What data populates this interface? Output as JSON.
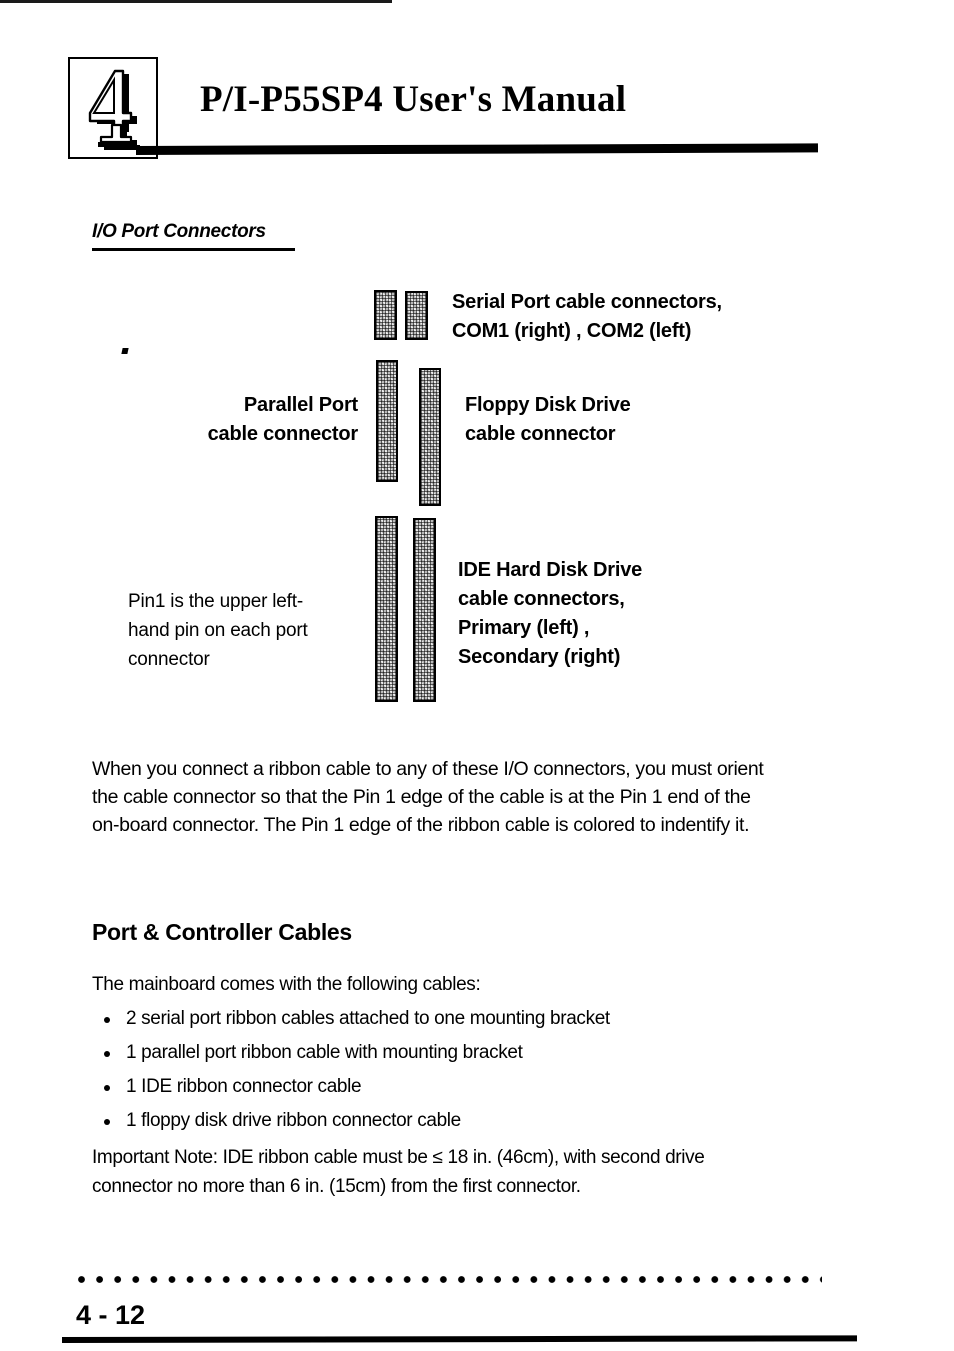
{
  "header": {
    "chapter_number": "4",
    "title": "P/I-P55SP4 User's Manual"
  },
  "section": {
    "heading": "I/O Port Connectors"
  },
  "diagram": {
    "serial_label_line1": "Serial Port cable connectors,",
    "serial_label_line2": "COM1 (right) , COM2 (left)",
    "parallel_label_line1": "Parallel Port",
    "parallel_label_line2": "cable connector",
    "floppy_label_line1": "Floppy Disk Drive",
    "floppy_label_line2": "cable connector",
    "pin1_note_line1": "Pin1 is the upper left-",
    "pin1_note_line2": "hand pin on each port",
    "pin1_note_line3": "connector",
    "ide_label_line1": "IDE Hard Disk Drive",
    "ide_label_line2": "cable connectors,",
    "ide_label_line3": "Primary (left) ,",
    "ide_label_line4": "Secondary  (right)",
    "connectors": [
      {
        "name": "com2-serial-connector"
      },
      {
        "name": "com1-serial-connector"
      },
      {
        "name": "parallel-port-connector"
      },
      {
        "name": "floppy-disk-connector"
      },
      {
        "name": "primary-ide-connector"
      },
      {
        "name": "secondary-ide-connector"
      }
    ]
  },
  "body": {
    "paragraph": "When you connect a ribbon cable to any of these I/O connectors, you must orient the cable connector so that the Pin 1 edge of the cable is at the Pin 1 end of the on-board connector. The Pin 1 edge of the ribbon cable is colored to indentify it."
  },
  "cables_section": {
    "subhead": "Port & Controller Cables",
    "lead": "The mainboard comes with the following cables:",
    "items": [
      "2 serial port ribbon cables attached to one mounting bracket",
      "1 parallel port ribbon cable with mounting bracket",
      "1 IDE ribbon connector cable",
      "1 floppy disk drive ribbon connector cable"
    ],
    "note": "Important Note: IDE ribbon cable must be ≤ 18 in. (46cm), with second drive connector no more than 6 in. (15cm) from the first connector."
  },
  "footer": {
    "page_number": "4 - 12"
  }
}
